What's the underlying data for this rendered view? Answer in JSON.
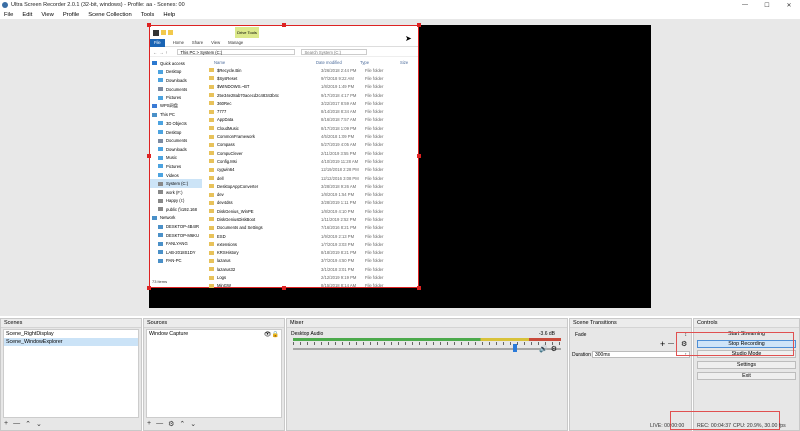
{
  "window": {
    "title": "Ultra Screen Recorder 2.0.1 (32-bit, windows) - Profile: aa - Scenes: 00"
  },
  "menu": [
    "File",
    "Edit",
    "View",
    "Profile",
    "Scene Collection",
    "Tools",
    "Help"
  ],
  "explorer": {
    "drive_tools": "Drive Tools",
    "ribbon_tabs": [
      "File",
      "Home",
      "Share",
      "View",
      "Manage"
    ],
    "path": "This PC  >  System (C:)",
    "search_placeholder": "Search System (C:)",
    "columns": [
      "Name",
      "Date modified",
      "Type",
      "Size"
    ],
    "nav": [
      {
        "label": "Quick access",
        "icon": "star-icon",
        "color": "#2b79d0"
      },
      {
        "label": "Desktop",
        "icon": "folder-icon",
        "color": "#4ca3e0"
      },
      {
        "label": "Downloads",
        "icon": "download-icon",
        "color": "#4ca3e0"
      },
      {
        "label": "Documents",
        "icon": "folder-icon",
        "color": "#7c8aa0"
      },
      {
        "label": "Pictures",
        "icon": "folder-icon",
        "color": "#4ca3e0"
      },
      {
        "label": "WPS网盘",
        "icon": "cloud-icon",
        "color": "#3a7bd5"
      },
      {
        "label": "This PC",
        "icon": "computer-icon",
        "color": "#4a90c8"
      },
      {
        "label": "3D Objects",
        "icon": "folder-icon",
        "color": "#4ca3e0"
      },
      {
        "label": "Desktop",
        "icon": "folder-icon",
        "color": "#4ca3e0"
      },
      {
        "label": "Documents",
        "icon": "folder-icon",
        "color": "#7c8aa0"
      },
      {
        "label": "Downloads",
        "icon": "download-icon",
        "color": "#4ca3e0"
      },
      {
        "label": "Music",
        "icon": "music-icon",
        "color": "#4ca3e0"
      },
      {
        "label": "Pictures",
        "icon": "folder-icon",
        "color": "#4ca3e0"
      },
      {
        "label": "Videos",
        "icon": "folder-icon",
        "color": "#4ca3e0"
      },
      {
        "label": "System (C:)",
        "icon": "drive-icon",
        "color": "#888888",
        "selected": true
      },
      {
        "label": "work (F:)",
        "icon": "drive-icon",
        "color": "#888888"
      },
      {
        "label": "Happy (I:)",
        "icon": "drive-icon",
        "color": "#888888"
      },
      {
        "label": "public (\\\\192.168",
        "icon": "network-drive-icon",
        "color": "#888888"
      },
      {
        "label": "Network",
        "icon": "network-icon",
        "color": "#4a90c8"
      },
      {
        "label": "DESKTOP-4B4IR",
        "icon": "computer-icon",
        "color": "#4a90c8"
      },
      {
        "label": "DESKTOP-M6KU",
        "icon": "computer-icon",
        "color": "#4a90c8"
      },
      {
        "label": "FANLYANG",
        "icon": "computer-icon",
        "color": "#4a90c8"
      },
      {
        "label": "LAB-2018S1DY",
        "icon": "computer-icon",
        "color": "#4a90c8"
      },
      {
        "label": "PAN-PC",
        "icon": "computer-icon",
        "color": "#4a90c8"
      }
    ],
    "files": [
      {
        "name": "$Recycle.Bin",
        "date": "3/26/2018 2:44 PM",
        "type": "File folder"
      },
      {
        "name": "$SysReset",
        "date": "9/7/2018 9:22 AM",
        "type": "File folder"
      },
      {
        "name": "$WINDOWS.~BT",
        "date": "1/8/2019 1:49 PM",
        "type": "File folder"
      },
      {
        "name": "25e34e28ab70acecd2c48343b4c",
        "date": "9/17/2018 4:17 PM",
        "type": "File folder"
      },
      {
        "name": "360Rec",
        "date": "3/22/2017 8:59 AM",
        "type": "File folder"
      },
      {
        "name": "7777",
        "date": "8/14/2018 8:34 AM",
        "type": "File folder"
      },
      {
        "name": "AppData",
        "date": "8/16/2018 7:57 AM",
        "type": "File folder"
      },
      {
        "name": "CloudMusic",
        "date": "8/17/2018 1:09 PM",
        "type": "File folder"
      },
      {
        "name": "CommonFramework",
        "date": "4/5/2018 1:09 PM",
        "type": "File folder"
      },
      {
        "name": "Compass",
        "date": "5/27/2019 4:05 AM",
        "type": "File folder"
      },
      {
        "name": "CompuClever",
        "date": "2/11/2019 3:55 PM",
        "type": "File folder"
      },
      {
        "name": "Config.Msi",
        "date": "4/10/2019 11:28 AM",
        "type": "File folder"
      },
      {
        "name": "cygwin64",
        "date": "12/19/2018 2:28 PM",
        "type": "File folder"
      },
      {
        "name": "dell",
        "date": "12/12/2016 3:08 PM",
        "type": "File folder"
      },
      {
        "name": "DesktopAppConverter",
        "date": "3/28/2018 9:26 AM",
        "type": "File folder"
      },
      {
        "name": "dev",
        "date": "1/8/2019 1:54 PM",
        "type": "File folder"
      },
      {
        "name": "dev4dss",
        "date": "3/28/2019 1:11 PM",
        "type": "File folder"
      },
      {
        "name": "DiskGenius_WinPE",
        "date": "1/8/2019 4:10 PM",
        "type": "File folder"
      },
      {
        "name": "DiskGeniusDiskBoot",
        "date": "1/11/2019 2:52 PM",
        "type": "File folder"
      },
      {
        "name": "Documents and Settings",
        "date": "7/16/2016 8:21 PM",
        "type": "File folder"
      },
      {
        "name": "ESD",
        "date": "1/9/2019 2:13 PM",
        "type": "File folder"
      },
      {
        "name": "extensions",
        "date": "1/7/2019 3:03 PM",
        "type": "File folder"
      },
      {
        "name": "KRSHistory",
        "date": "8/18/2019 8:21 PM",
        "type": "File folder"
      },
      {
        "name": "lazarus",
        "date": "3/7/2019 4:50 PM",
        "type": "File folder"
      },
      {
        "name": "lazarus32",
        "date": "3/1/2018 3:01 PM",
        "type": "File folder"
      },
      {
        "name": "Logs",
        "date": "2/12/2019 9:19 PM",
        "type": "File folder"
      },
      {
        "name": "MinGW",
        "date": "8/15/2018 8:14 AM",
        "type": "File folder"
      }
    ],
    "status": "73 items"
  },
  "scenes": {
    "title": "Scenes",
    "items": [
      "Scene_RightDisplay",
      "Scene_WindowExplorer"
    ],
    "selected": 1
  },
  "sources": {
    "title": "Sources",
    "items": [
      "Window Capture"
    ]
  },
  "mixer": {
    "title": "Mixer",
    "track": "Desktop Audio",
    "db": "-3.6 dB",
    "volume_level": 0.83
  },
  "transitions": {
    "title": "Scene Transitions",
    "selected": "Fade",
    "duration_label": "Duration",
    "duration": "300ms"
  },
  "controls": {
    "title": "Controls",
    "buttons": [
      "Start Streaming",
      "Stop Recording",
      "Studio Mode",
      "Settings",
      "Exit"
    ],
    "active": 1
  },
  "status": {
    "live": "LIVE: 00:00:00",
    "rec": "REC: 00:04:37",
    "cpu": "CPU: 20.9%, 30.00 fps"
  }
}
